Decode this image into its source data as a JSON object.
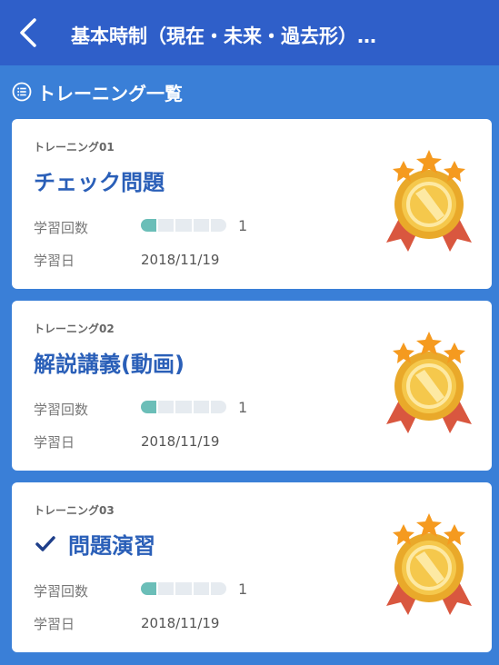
{
  "header": {
    "title": "基本時制（現在・未来・過去形）…"
  },
  "section": {
    "label": "トレーニング一覧"
  },
  "cards": [
    {
      "id": "トレーニング01",
      "title": "チェック問題",
      "count_label": "学習回数",
      "count": "1",
      "progress": 0.2,
      "date_label": "学習日",
      "date": "2018/11/19",
      "checked": false
    },
    {
      "id": "トレーニング02",
      "title": "解説講義(動画)",
      "count_label": "学習回数",
      "count": "1",
      "progress": 0.2,
      "date_label": "学習日",
      "date": "2018/11/19",
      "checked": false
    },
    {
      "id": "トレーニング03",
      "title": "問題演習",
      "count_label": "学習回数",
      "count": "1",
      "progress": 0.2,
      "date_label": "学習日",
      "date": "2018/11/19",
      "checked": true
    }
  ],
  "colors": {
    "header": "#2f5fc9",
    "background": "#3a7fd7",
    "title": "#2a5fb8",
    "progress": "#6bbeb8"
  },
  "icons": {
    "back": "chevron-left-icon",
    "list": "list-icon",
    "check": "check-icon",
    "medal": "gold-medal-icon"
  }
}
